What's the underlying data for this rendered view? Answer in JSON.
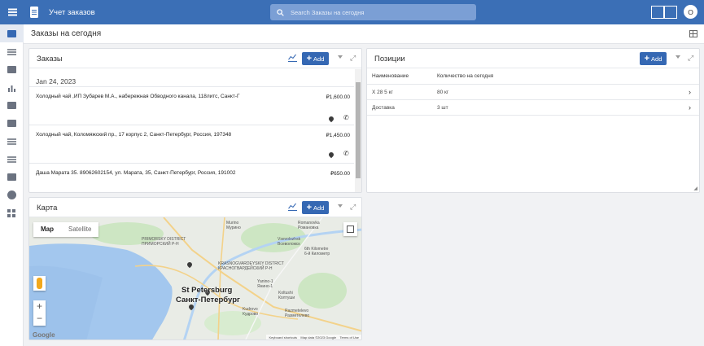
{
  "app": {
    "title": "Учет заказов",
    "user_initial": "O"
  },
  "search": {
    "placeholder": "Search Заказы на сегодня"
  },
  "page": {
    "title": "Заказы на сегодня"
  },
  "orders_panel": {
    "title": "Заказы",
    "add_label": "Add",
    "date": "Jan 24, 2023",
    "items": [
      {
        "text": "Холодный чай ,ИП Зубарев М.А., набережная Обводного канала, 118литс, Санкт-Г",
        "price": "₽1,600.00"
      },
      {
        "text": "Холодный чай, Коломяжский пр., 17 корпус 2, Санкт-Петербург, Россия, 197348",
        "price": "₽1,450.00"
      },
      {
        "text": "Даша Марата 35. 89062602154, ул. Марата, 35, Санкт-Петербург, Россия, 191002",
        "price": "₽650.00"
      }
    ]
  },
  "positions_panel": {
    "title": "Позиции",
    "add_label": "Add",
    "columns": [
      "Наименование",
      "Количество на сегодня"
    ],
    "rows": [
      {
        "name": "Х 28 5 кг",
        "qty": "80 кг"
      },
      {
        "name": "Доставка",
        "qty": "3 шт"
      }
    ]
  },
  "map_panel": {
    "title": "Карта",
    "add_label": "Add",
    "map_tab": "Map",
    "satellite_tab": "Satellite",
    "zoom_in": "+",
    "zoom_out": "−",
    "city_en": "St Petersburg",
    "city_ru": "Санкт-Петербург",
    "labels": {
      "murino": "Murino",
      "murino_ru": "Мурино",
      "romanovka": "Romanovka",
      "romanovka_ru": "Романовка",
      "primorsky": "PRIMORSKY DISTRICT",
      "primorsky_ru": "ПРИМОРСКИЙ Р-Н",
      "vsevolozhsk": "Vsevolozhsk",
      "vsevolozhsk_ru": "Всеволожск",
      "kilometre": "6th Kilometre",
      "kilometre_ru": "6-й Километр",
      "krasnogvard": "KRASNOGVARDEYSKIY DISTRICT",
      "krasnogvard_ru": "КРАСНОГВАРДЕЙСКИЙ Р-Н",
      "yanino": "Yanino-1",
      "yanino_ru": "Янино-1",
      "koltushi": "Koltushi",
      "koltushi_ru": "Колтуши",
      "kudrovo": "Kudrovo",
      "kudrovo_ru": "Кудрово",
      "razmetelevo": "Razmetelevo",
      "razmetelevo_ru": "Разметелево",
      "shortcuts": "Keyboard shortcuts",
      "mapdata": "Map data ©2023 Google",
      "terms": "Terms of Use",
      "google": "Google"
    }
  },
  "colors": {
    "topbar": "#3b6fb6",
    "accent": "#3568b3",
    "water": "#a3c7ee",
    "land": "#e9ece6",
    "park": "#cde6c3"
  }
}
